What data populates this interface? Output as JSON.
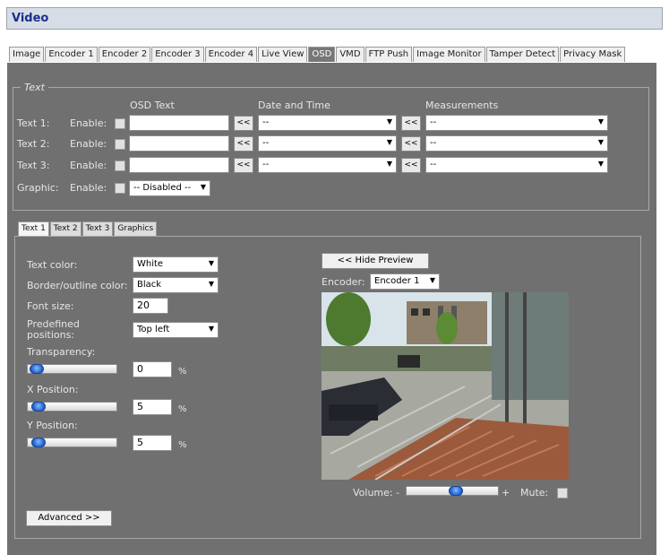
{
  "page": {
    "title": "Video"
  },
  "tabs": [
    {
      "label": "Image",
      "active": false
    },
    {
      "label": "Encoder 1",
      "active": false
    },
    {
      "label": "Encoder 2",
      "active": false
    },
    {
      "label": "Encoder 3",
      "active": false
    },
    {
      "label": "Encoder 4",
      "active": false
    },
    {
      "label": "Live View",
      "active": false
    },
    {
      "label": "OSD",
      "active": true
    },
    {
      "label": "VMD",
      "active": false
    },
    {
      "label": "FTP Push",
      "active": false
    },
    {
      "label": "Image Monitor",
      "active": false
    },
    {
      "label": "Tamper Detect",
      "active": false
    },
    {
      "label": "Privacy Mask",
      "active": false
    }
  ],
  "text_group": {
    "legend": "Text",
    "headers": {
      "osd_text": "OSD Text",
      "date_time": "Date and Time",
      "measurements": "Measurements"
    },
    "enable_label": "Enable:",
    "insert_button": "<<",
    "rows": [
      {
        "label": "Text 1:",
        "osd_value": "",
        "date_time": "--",
        "measurement": "--"
      },
      {
        "label": "Text 2:",
        "osd_value": "",
        "date_time": "--",
        "measurement": "--"
      },
      {
        "label": "Text 3:",
        "osd_value": "",
        "date_time": "--",
        "measurement": "--"
      }
    ],
    "graphic": {
      "label": "Graphic:",
      "value": "-- Disabled --"
    }
  },
  "sub_tabs": [
    {
      "label": "Text 1",
      "active": true
    },
    {
      "label": "Text 2",
      "active": false
    },
    {
      "label": "Text 3",
      "active": false
    },
    {
      "label": "Graphics",
      "active": false
    }
  ],
  "settings": {
    "text_color": {
      "label": "Text color:",
      "value": "White"
    },
    "border_color": {
      "label": "Border/outline color:",
      "value": "Black"
    },
    "font_size": {
      "label": "Font size:",
      "value": "20"
    },
    "predefined": {
      "label_line1": "Predefined",
      "label_line2": "positions:",
      "value": "Top left"
    },
    "transparency": {
      "label": "Transparency:",
      "value": "0",
      "unit": "%",
      "level": 0.03
    },
    "x_position": {
      "label": "X Position:",
      "value": "5",
      "unit": "%",
      "level": 0.05
    },
    "y_position": {
      "label": "Y Position:",
      "value": "5",
      "unit": "%",
      "level": 0.05
    },
    "advanced_button": "Advanced >>"
  },
  "preview": {
    "hide_button": "<< Hide Preview",
    "encoder_label": "Encoder:",
    "encoder_value": "Encoder 1",
    "volume_label": "Volume: -",
    "volume_plus": "+",
    "volume_level": 0.55,
    "mute_label": "Mute:"
  },
  "colors": {
    "panel": "#707070",
    "title_text": "#1a2f8a",
    "active_tab": "#777777"
  }
}
